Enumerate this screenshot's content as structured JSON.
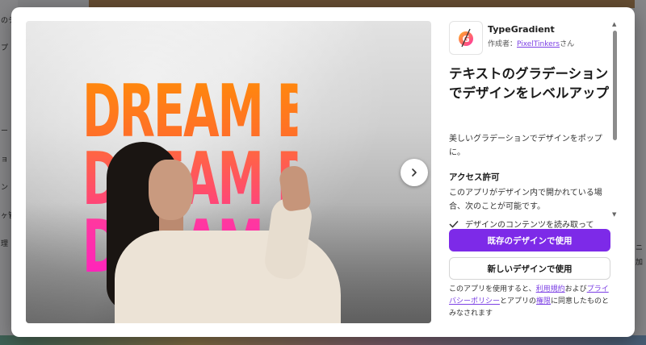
{
  "background": {
    "left_fragments": [
      "のテ",
      "プ",
      "ー",
      "ョ",
      "ン",
      "ヶ管",
      "理"
    ],
    "right_fragments": [
      "ニ",
      "加"
    ]
  },
  "preview": {
    "poster_lines": [
      "DREAM BIG",
      "DREAM BIG",
      "DREAM BIG"
    ],
    "next_icon": "chevron-right-icon"
  },
  "app": {
    "name": "TypeGradient",
    "author_prefix": "作成者：",
    "author_name": "PixelTinkers",
    "author_suffix": "さん",
    "logo_icon": "typegradient-logo"
  },
  "content": {
    "title": "テキストのグラデーションでデザインをレベルアップ",
    "description": "美しいグラデーションでデザインをポップに。",
    "permissions_heading": "アクセス許可",
    "permissions_description": "このアプリがデザイン内で開かれている場合、次のことが可能です。",
    "permission_items": [
      "デザインのコンテンツを読み取って"
    ]
  },
  "actions": {
    "use_existing": "既存のデザインで使用",
    "use_new": "新しいデザインで使用"
  },
  "terms": {
    "part1": "このアプリを使用すると、",
    "terms_link": "利用規約",
    "part2": "および",
    "privacy_link": "プライバシーポリシー",
    "part3": "とアプリの",
    "permissions_link": "権限",
    "part4": "に同意したものとみなされます"
  },
  "colors": {
    "primary": "#7d2ae8",
    "link": "#7b3fe4",
    "gradient_top": "#ff8a0a",
    "gradient_bottom": "#ff20c0"
  }
}
